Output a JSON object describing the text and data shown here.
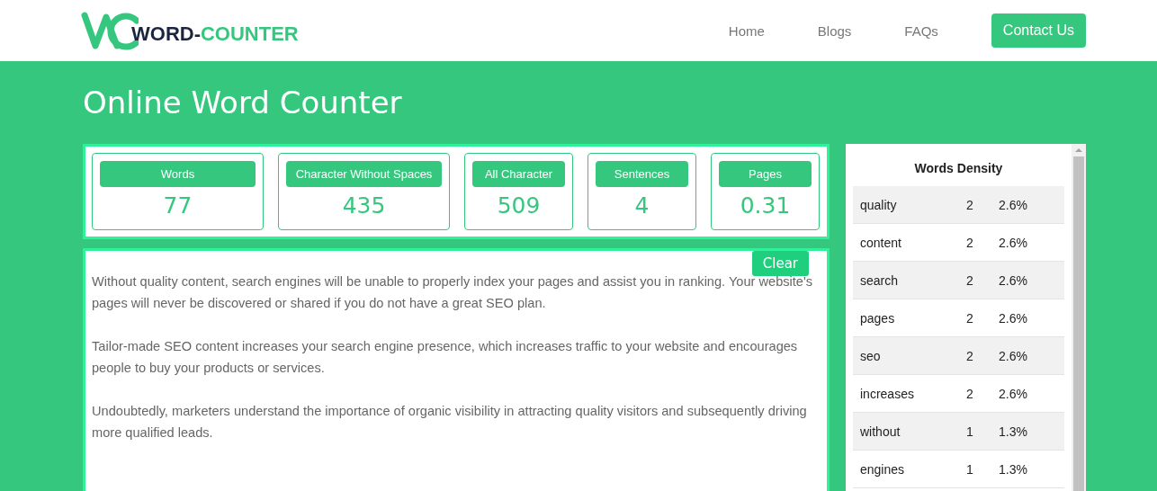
{
  "header": {
    "logo": {
      "word": "WORD-",
      "accent": "COUNTER"
    },
    "nav": [
      "Home",
      "Blogs",
      "FAQs"
    ],
    "cta": "Contact Us"
  },
  "title": "Online Word Counter",
  "stats": [
    {
      "label": "Words",
      "value": "77"
    },
    {
      "label": "Character Without Spaces",
      "value": "435"
    },
    {
      "label": "All Character",
      "value": "509"
    },
    {
      "label": "Sentences",
      "value": "4"
    },
    {
      "label": "Pages",
      "value": "0.31"
    }
  ],
  "editor": {
    "clear": "Clear",
    "paragraphs": [
      "Without quality content, search engines will be unable to properly index your pages and assist you in ranking. Your website's pages will never be discovered or shared if you do not have a great SEO plan.",
      "Tailor-made SEO content increases your search engine presence, which increases traffic to your website and encourages people to buy your products or services.",
      "Undoubtedly, marketers understand the importance of organic visibility in attracting quality visitors and subsequently driving more qualified leads."
    ]
  },
  "density": {
    "title": "Words Density",
    "rows": [
      {
        "word": "quality",
        "count": "2",
        "percent": "2.6%"
      },
      {
        "word": "content",
        "count": "2",
        "percent": "2.6%"
      },
      {
        "word": "search",
        "count": "2",
        "percent": "2.6%"
      },
      {
        "word": "pages",
        "count": "2",
        "percent": "2.6%"
      },
      {
        "word": "seo",
        "count": "2",
        "percent": "2.6%"
      },
      {
        "word": "increases",
        "count": "2",
        "percent": "2.6%"
      },
      {
        "word": "without",
        "count": "1",
        "percent": "1.3%"
      },
      {
        "word": "engines",
        "count": "1",
        "percent": "1.3%"
      }
    ]
  }
}
